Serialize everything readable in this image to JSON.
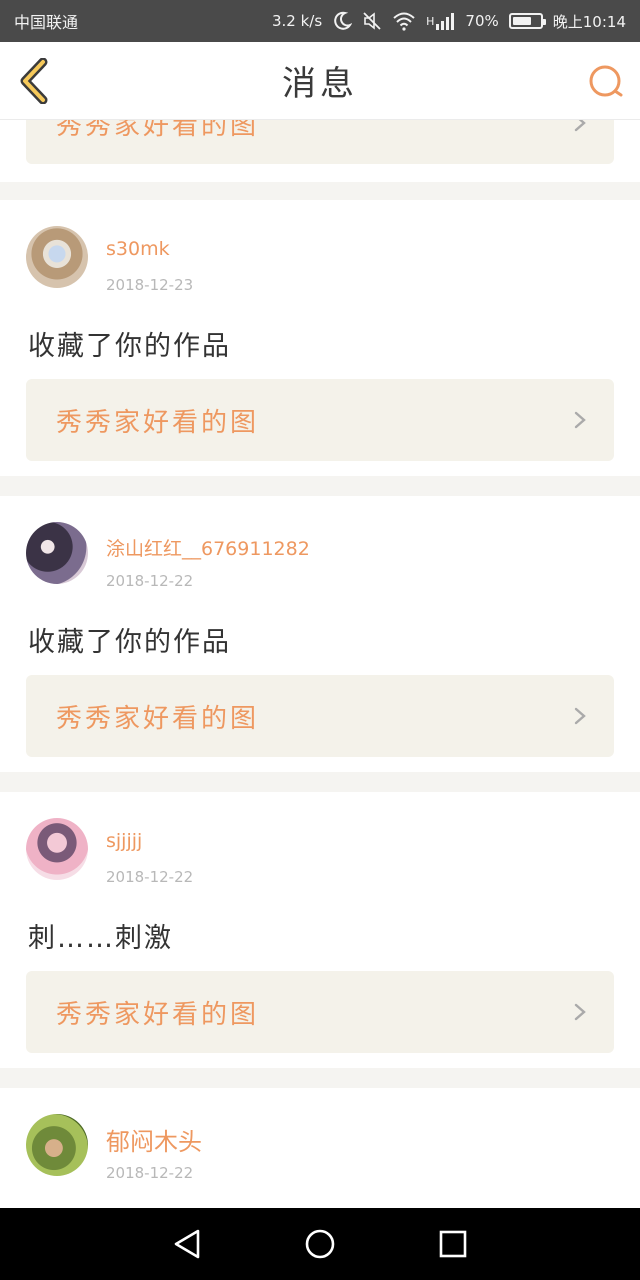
{
  "status_bar": {
    "carrier": "中国联通",
    "speed": "3.2 k/s",
    "signal_label": "H",
    "battery": "70%",
    "battery_level": 0.7,
    "time": "晚上10:14"
  },
  "header": {
    "title": "消息",
    "back_icon": "chevron-left-icon",
    "search_icon": "search-icon"
  },
  "colors": {
    "accent": "#ee9860",
    "link_box_bg": "#f4f2ea",
    "separator": "#f5f4f1"
  },
  "messages": [
    {
      "link_text": "秀秀家好看的图"
    },
    {
      "username": "s30mk",
      "date": "2018-12-23",
      "message": "收藏了你的作品",
      "link_text": "秀秀家好看的图"
    },
    {
      "username": "涂山红红__676911282",
      "date": "2018-12-22",
      "message": "收藏了你的作品",
      "link_text": "秀秀家好看的图"
    },
    {
      "username": "sjjjjj",
      "date": "2018-12-22",
      "message": "刺……刺激",
      "link_text": "秀秀家好看的图"
    },
    {
      "username": "郁闷木头",
      "date": "2018-12-22"
    }
  ]
}
